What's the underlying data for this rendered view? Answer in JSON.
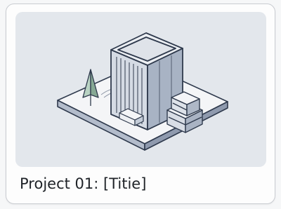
{
  "card": {
    "title": "Project 01: [Titie]",
    "thumbnail": {
      "subject": "isometric-building-illustration"
    }
  },
  "colors": {
    "page_background": "#f6f7f8",
    "card_background": "#fdfdfd",
    "card_border": "#c9ccd1",
    "thumbnail_background": "#e3e7ec",
    "title_text": "#1f2328",
    "building_front": "#d5dbe4",
    "building_side": "#aab4c4",
    "building_outline": "#2f3a4d",
    "tree_fill": "#a9c8b6"
  }
}
